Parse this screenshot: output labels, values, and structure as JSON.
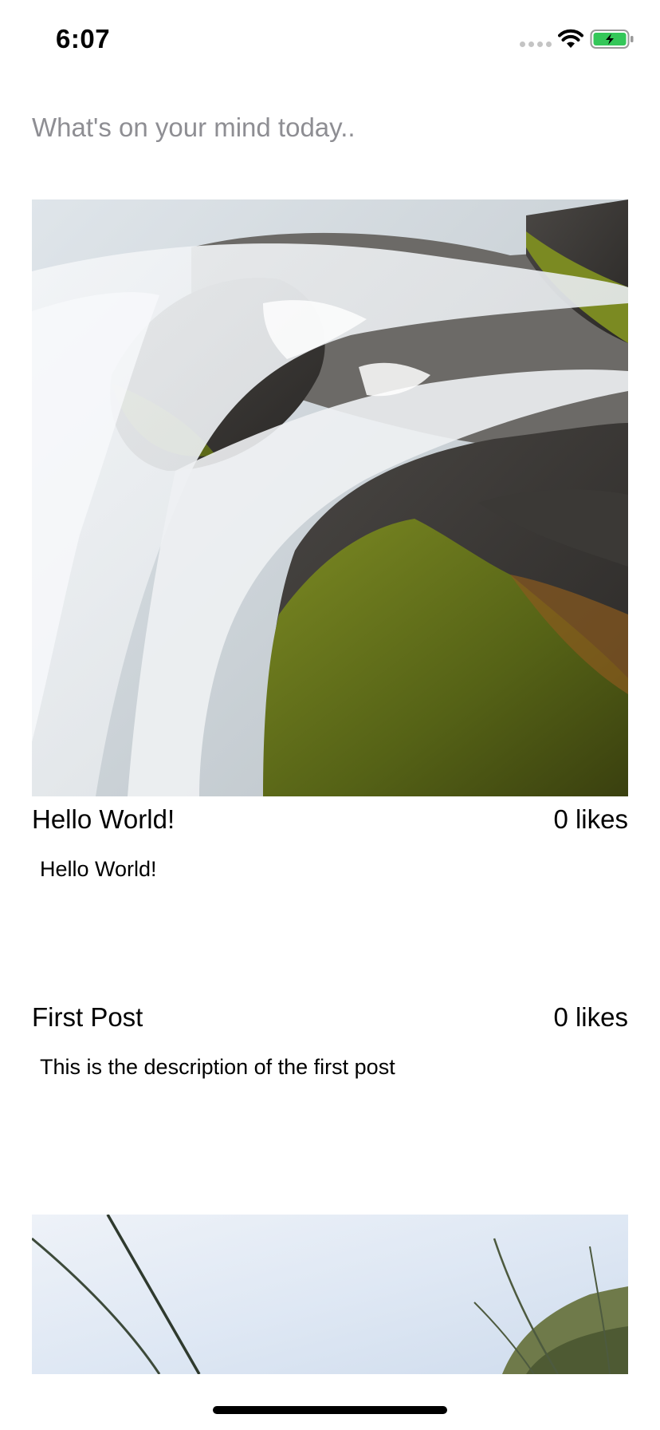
{
  "status_bar": {
    "time": "6:07",
    "battery_color": "#34c759"
  },
  "composer": {
    "placeholder": "What's on your mind today.."
  },
  "posts": [
    {
      "title": "Hello World!",
      "likes": "0 likes",
      "description": "Hello World!",
      "image": "waterfall-photo"
    },
    {
      "title": "First Post",
      "likes": "0 likes",
      "description": "This is the description of the first post"
    },
    {
      "image": "grass-sky-photo"
    }
  ],
  "colors": {
    "placeholder": "#8e8e93",
    "moss": "#6b7a1e",
    "water": "#e8ecef"
  }
}
